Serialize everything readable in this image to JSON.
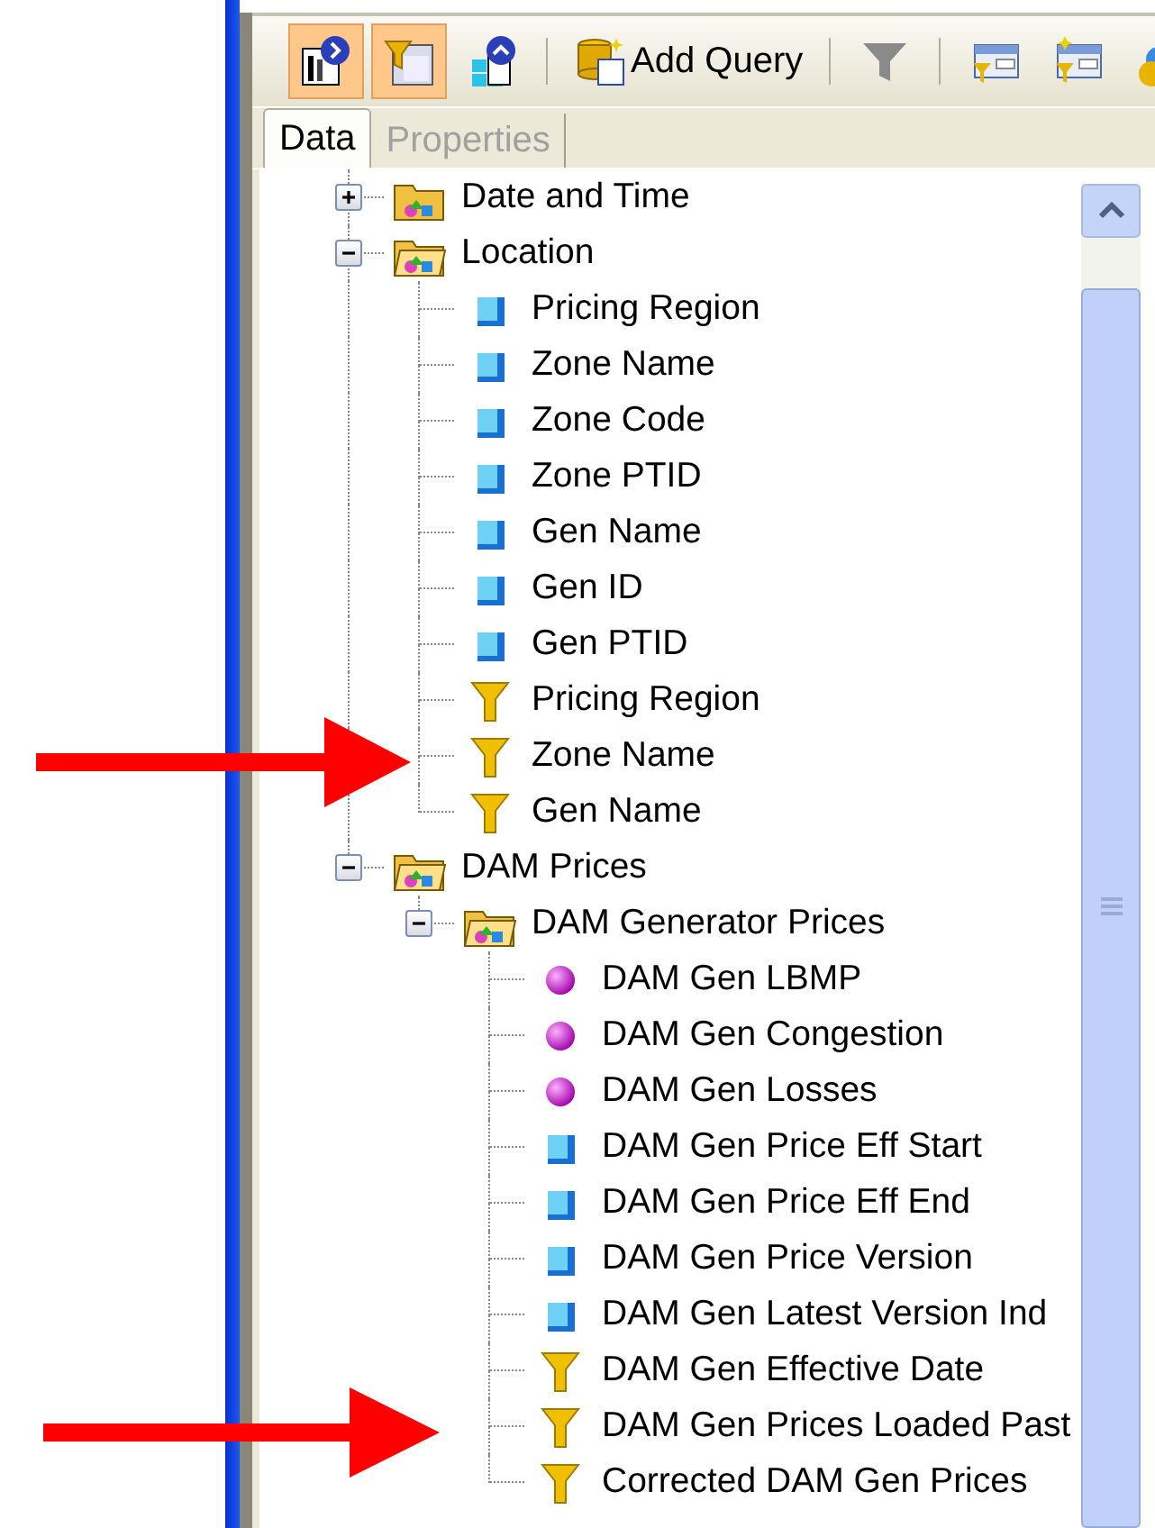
{
  "toolbar": {
    "items": [
      {
        "kind": "report",
        "on": true
      },
      {
        "kind": "filter-panel",
        "on": true
      },
      {
        "kind": "cubes",
        "on": false
      },
      {
        "kind": "separator"
      },
      {
        "kind": "query",
        "label": "Add Query",
        "on": false
      },
      {
        "kind": "separator"
      },
      {
        "kind": "funnel",
        "on": false
      },
      {
        "kind": "separator"
      },
      {
        "kind": "filter-form",
        "on": false
      },
      {
        "kind": "new-filter",
        "on": false
      },
      {
        "kind": "spheres",
        "on": false
      }
    ]
  },
  "tabs": [
    {
      "label": "Data",
      "selected": true
    },
    {
      "label": "Properties",
      "selected": false
    }
  ],
  "tree": [
    {
      "kind": "folder",
      "label": "Date and Time",
      "expanded": false
    },
    {
      "kind": "folder",
      "label": "Location",
      "expanded": true,
      "children": [
        {
          "kind": "dimension",
          "label": "Pricing Region"
        },
        {
          "kind": "dimension",
          "label": "Zone Name"
        },
        {
          "kind": "dimension",
          "label": "Zone Code"
        },
        {
          "kind": "dimension",
          "label": "Zone PTID"
        },
        {
          "kind": "dimension",
          "label": "Gen Name"
        },
        {
          "kind": "dimension",
          "label": "Gen ID"
        },
        {
          "kind": "dimension",
          "label": "Gen PTID"
        },
        {
          "kind": "filter",
          "label": "Pricing Region"
        },
        {
          "kind": "filter",
          "label": "Zone Name"
        },
        {
          "kind": "filter",
          "label": "Gen Name"
        }
      ]
    },
    {
      "kind": "folder",
      "label": "DAM Prices",
      "expanded": true,
      "children": [
        {
          "kind": "folder",
          "label": "DAM Generator Prices",
          "expanded": true,
          "children": [
            {
              "kind": "measure",
              "label": "DAM Gen LBMP"
            },
            {
              "kind": "measure",
              "label": "DAM Gen Congestion"
            },
            {
              "kind": "measure",
              "label": "DAM Gen Losses"
            },
            {
              "kind": "dimension",
              "label": "DAM Gen Price Eff Start"
            },
            {
              "kind": "dimension",
              "label": "DAM Gen Price Eff End"
            },
            {
              "kind": "dimension",
              "label": "DAM Gen Price Version"
            },
            {
              "kind": "dimension",
              "label": "DAM Gen Latest Version Ind"
            },
            {
              "kind": "filter",
              "label": "DAM Gen Effective Date"
            },
            {
              "kind": "filter",
              "label": "DAM Gen Prices Loaded Past"
            },
            {
              "kind": "filter",
              "label": "Corrected DAM Gen Prices"
            }
          ]
        }
      ]
    }
  ]
}
